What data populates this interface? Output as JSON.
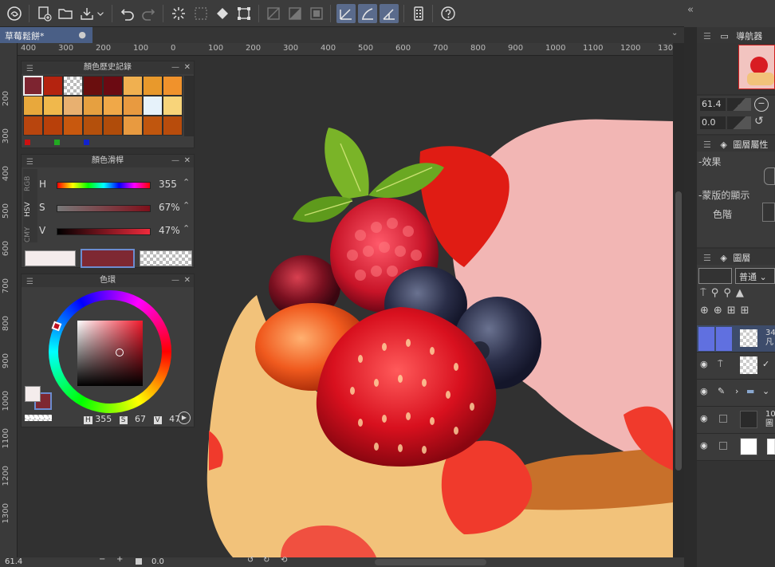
{
  "document": {
    "tab_title": "草莓鬆餅*"
  },
  "ruler": {
    "h_ticks": [
      "400",
      "300",
      "200",
      "100",
      "0",
      "100",
      "200",
      "300",
      "400",
      "500",
      "600",
      "700",
      "800",
      "900",
      "1000",
      "1100",
      "1200",
      "1300"
    ],
    "v_ticks": [
      "200",
      "300",
      "400",
      "500",
      "600",
      "700",
      "800",
      "900",
      "1000",
      "1100",
      "1200",
      "1300"
    ]
  },
  "toolbar": {
    "icons": [
      "app-logo-icon",
      "new-file-icon",
      "open-folder-icon",
      "export-icon",
      "dropdown-chevron-icon",
      "undo-icon",
      "redo-icon",
      "sparkle-icon",
      "deselect-icon",
      "fill-icon",
      "transform-icon",
      "grid-off-icon",
      "fill-layer-icon",
      "crop-icon",
      "ruler-a-icon",
      "ruler-b-icon",
      "ruler-c-icon",
      "tablet-icon",
      "help-icon"
    ]
  },
  "color_history": {
    "title": "顏色歷史記錄",
    "swatches": [
      "#7d2430",
      "#b4230f",
      "checker",
      "#6a0e0e",
      "#6b0a12",
      "#f0b050",
      "#e8992c",
      "#f0922c",
      "#e8a83c",
      "#f0b84c",
      "#e8b070",
      "#e6a040",
      "#f0a848",
      "#e89a40",
      "#e6f2fa",
      "#f8d47a",
      "#b8450e",
      "#b8400a",
      "#c8580e",
      "#b4500c",
      "#b04c0a",
      "#e89a40",
      "#c0560e",
      "#b84c0c"
    ],
    "marker_colors": [
      "#cc1111",
      "#22aa22",
      "#1122cc"
    ]
  },
  "color_slider": {
    "title": "顏色滑桿",
    "side_tabs": [
      "RGB",
      "HSV",
      "CMY"
    ],
    "rows": [
      {
        "label": "H",
        "value": "355"
      },
      {
        "label": "S",
        "value": "67%"
      },
      {
        "label": "V",
        "value": "47%"
      }
    ],
    "colors": {
      "current": "#7e2832",
      "bg": "#f4ecec"
    }
  },
  "color_wheel": {
    "title": "色環",
    "readout": {
      "h_label": "H",
      "h": "355",
      "s_label": "S",
      "s": "67",
      "v_label": "V",
      "v": "47"
    }
  },
  "status": {
    "zoom": "61.4",
    "angle": "0.0"
  },
  "right_panel": {
    "navigator_label": "導航器",
    "zoom_value": "61.4",
    "rotate_value": "0.0",
    "layer_property_title": "圖層屬性",
    "effect_label": "效果",
    "mask_label": "蒙版的顯示",
    "tone_label": "色階",
    "layers_title": "圖層",
    "blend_mode": "普通",
    "layers": [
      {
        "name": "34",
        "sub": "凡"
      },
      {
        "name": "",
        "sub": ""
      },
      {
        "name": "",
        "sub": ""
      },
      {
        "name": "10",
        "sub": "圖"
      },
      {
        "name": "",
        "sub": ""
      }
    ]
  }
}
